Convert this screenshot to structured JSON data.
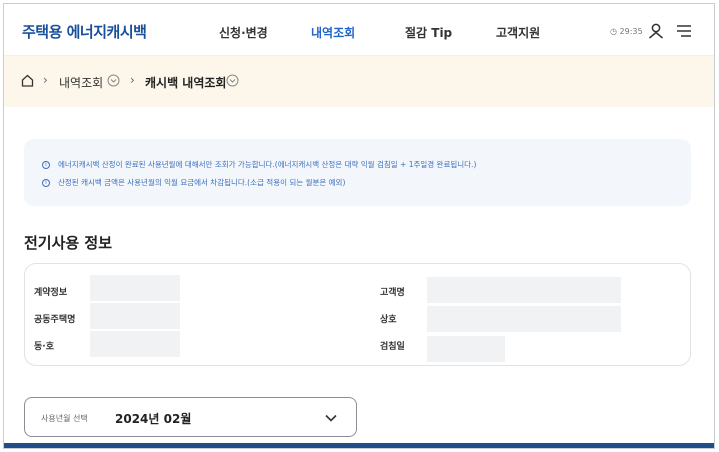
{
  "header": {
    "logo": "주택용 에너지캐시백",
    "nav": [
      "신청·변경",
      "내역조회",
      "절감 Tip",
      "고객지원"
    ],
    "active_nav": "내역조회",
    "timer": "29:35"
  },
  "breadcrumb": {
    "items": [
      "내역조회",
      "캐시백 내역조회"
    ]
  },
  "notice": {
    "lines": [
      "에너지캐시백 산정이 완료된 사용년월에 대해서만 조회가 가능합니다.(에너지캐시백 산정은 대략 익월 검침일 + 1주일경 완료됩니다.)",
      "산정된 캐시백 금액은 사용년월의 익월 요금에서 차감됩니다.(소급 적용이 되는 월분은 예외)"
    ]
  },
  "section": {
    "title": "전기사용 정보"
  },
  "info": {
    "contract_label": "계약정보",
    "apartment_label": "공동주택명",
    "unit_label": "동·호",
    "customer_label": "고객명",
    "business_label": "상호",
    "meter_label": "검침일"
  },
  "select": {
    "label": "사용년월 선택",
    "value": "2024년 02월"
  },
  "colors": {
    "brand": "#1a4f9c",
    "active": "#1f63c8",
    "crumb_bg": "#fcf7ea",
    "notice_text": "#3c6fc2",
    "bottom_bar": "#1f4e8a"
  }
}
